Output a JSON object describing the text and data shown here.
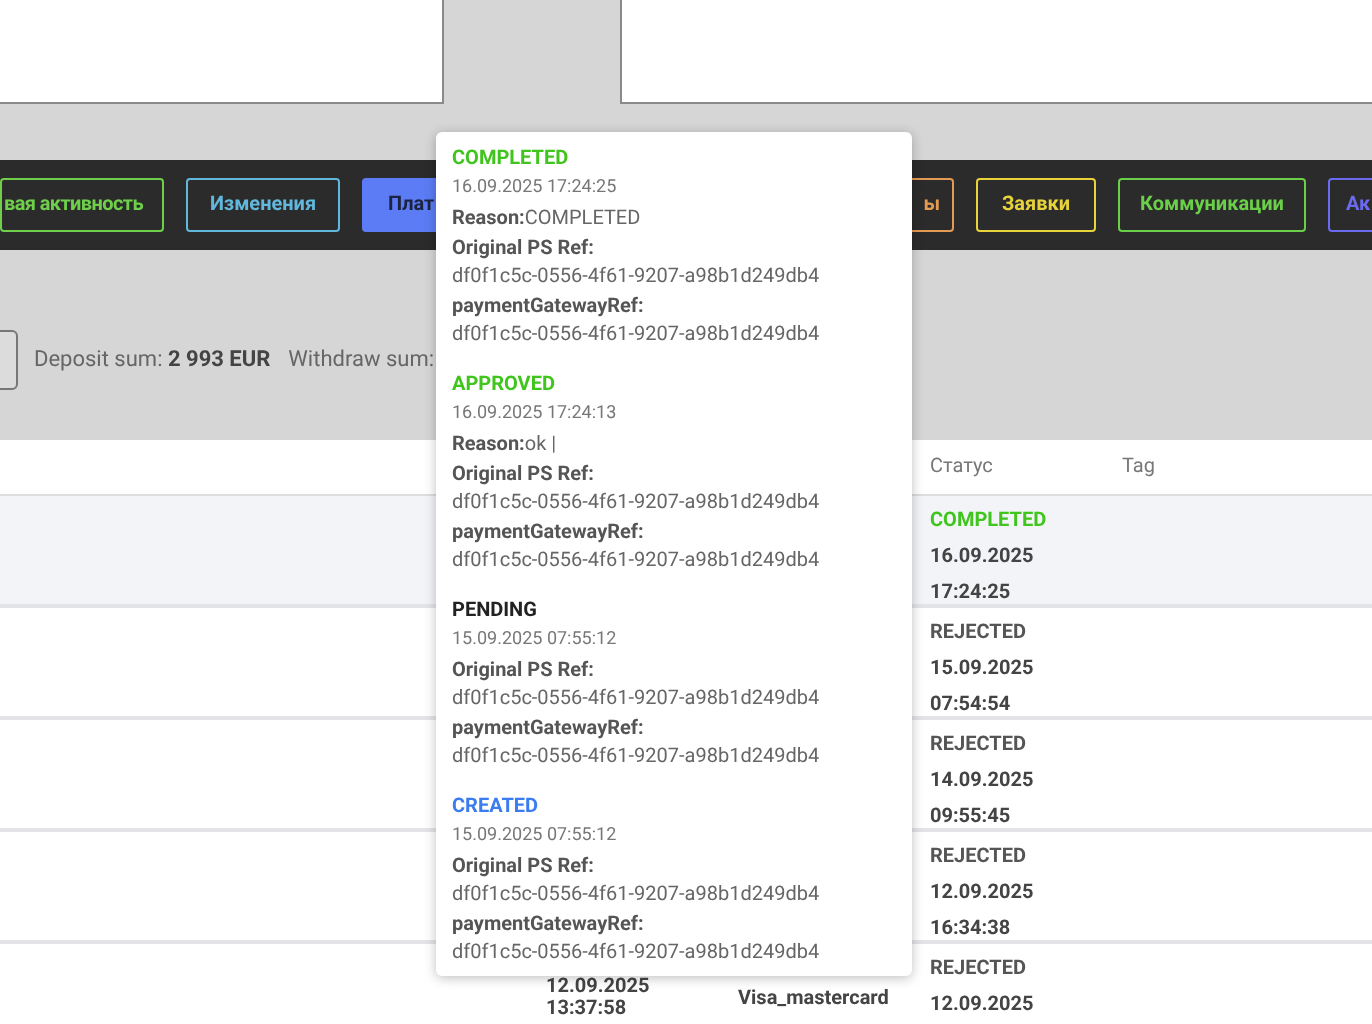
{
  "tabs": [
    {
      "label": "вая активность",
      "color": "#6fcf4a",
      "selected": false
    },
    {
      "label": "Изменения",
      "color": "#62b8dc",
      "selected": false
    },
    {
      "label": "Плат",
      "color": "#5b7cf5",
      "selected": true
    },
    {
      "label": "ы",
      "color": "#e39a52",
      "selected": false
    },
    {
      "label": "Заявки",
      "color": "#e8d43a",
      "selected": false
    },
    {
      "label": "Коммуникации",
      "color": "#6ccf4a",
      "selected": false
    },
    {
      "label": "Ак",
      "color": "#6b6bf0",
      "selected": false
    }
  ],
  "summary": {
    "deposit_label": "Deposit sum:",
    "deposit_value": "2 993 EUR",
    "withdraw_label": "Withdraw sum:"
  },
  "table": {
    "columns": [
      "Статус",
      "Tag"
    ],
    "rows": [
      {
        "selected": true,
        "status": "COMPLETED",
        "color": "#3fc51c",
        "status_date": "16.09.2025",
        "status_time": "17:24:25"
      },
      {
        "selected": false,
        "status": "REJECTED",
        "color": "#555555",
        "status_date": "15.09.2025",
        "status_time": "07:54:54"
      },
      {
        "selected": false,
        "status": "REJECTED",
        "color": "#555555",
        "status_date": "14.09.2025",
        "status_time": "09:55:45"
      },
      {
        "selected": false,
        "status": "REJECTED",
        "color": "#555555",
        "status_date": "12.09.2025",
        "status_time": "16:34:38"
      },
      {
        "selected": false,
        "date": "12.09.2025",
        "time": "13:37:58",
        "method": "Visa_mastercard",
        "status": "REJECTED",
        "color": "#555555",
        "status_date": "12.09.2025"
      }
    ]
  },
  "popover": {
    "entries": [
      {
        "status": "COMPLETED",
        "color": "#3fc51c",
        "timestamp": "16.09.2025 17:24:25",
        "fields": [
          {
            "kind": "inline",
            "label": "Reason:",
            "value": "COMPLETED"
          },
          {
            "kind": "block",
            "label": "Original PS Ref:",
            "value": "df0f1c5c-0556-4f61-9207-a98b1d249db4"
          },
          {
            "kind": "block",
            "label": "paymentGatewayRef:",
            "value": "df0f1c5c-0556-4f61-9207-a98b1d249db4"
          }
        ]
      },
      {
        "status": "APPROVED",
        "color": "#3fc51c",
        "timestamp": "16.09.2025 17:24:13",
        "fields": [
          {
            "kind": "inline",
            "label": "Reason:",
            "value": "ok |"
          },
          {
            "kind": "block",
            "label": "Original PS Ref:",
            "value": "df0f1c5c-0556-4f61-9207-a98b1d249db4"
          },
          {
            "kind": "block",
            "label": "paymentGatewayRef:",
            "value": "df0f1c5c-0556-4f61-9207-a98b1d249db4"
          }
        ]
      },
      {
        "status": "PENDING",
        "color": "#222222",
        "timestamp": "15.09.2025 07:55:12",
        "fields": [
          {
            "kind": "block",
            "label": "Original PS Ref:",
            "value": "df0f1c5c-0556-4f61-9207-a98b1d249db4"
          },
          {
            "kind": "block",
            "label": "paymentGatewayRef:",
            "value": "df0f1c5c-0556-4f61-9207-a98b1d249db4"
          }
        ]
      },
      {
        "status": "CREATED",
        "color": "#3b7cf0",
        "timestamp": "15.09.2025 07:55:12",
        "fields": [
          {
            "kind": "block",
            "label": "Original PS Ref:",
            "value": "df0f1c5c-0556-4f61-9207-a98b1d249db4"
          },
          {
            "kind": "block",
            "label": "paymentGatewayRef:",
            "value": "df0f1c5c-0556-4f61-9207-a98b1d249db4"
          }
        ]
      }
    ]
  }
}
